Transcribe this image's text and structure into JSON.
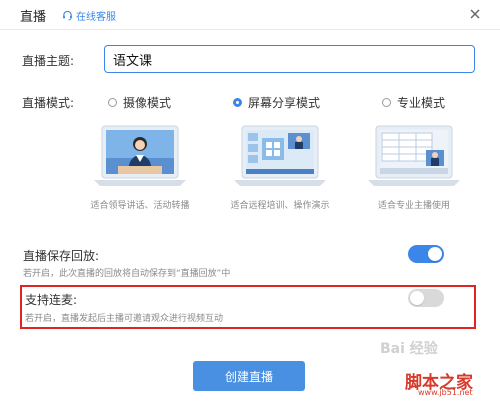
{
  "header": {
    "title": "直播",
    "service_label": "在线客服"
  },
  "subject": {
    "label": "直播主题:",
    "value": "语文课"
  },
  "mode": {
    "label": "直播模式:",
    "options": [
      {
        "label": "摄像模式",
        "desc": "适合领导讲话、活动转播",
        "selected": false
      },
      {
        "label": "屏幕分享模式",
        "desc": "适合远程培训、操作演示",
        "selected": true
      },
      {
        "label": "专业模式",
        "desc": "适合专业主播使用",
        "selected": false
      }
    ]
  },
  "replay": {
    "title": "直播保存回放:",
    "desc": "若开启，此次直播的回放将自动保存到“直播回放”中",
    "enabled": true
  },
  "mic": {
    "title": "支持连麦:",
    "desc": "若开启，直播发起后主播可邀请观众进行视频互动",
    "enabled": false
  },
  "create_button": "创建直播",
  "watermark": {
    "baidu": "Bai 经验",
    "site": "脚本之家",
    "url": "www.jb51.net"
  },
  "colors": {
    "accent": "#3b86e8",
    "highlight": "#e02424"
  }
}
